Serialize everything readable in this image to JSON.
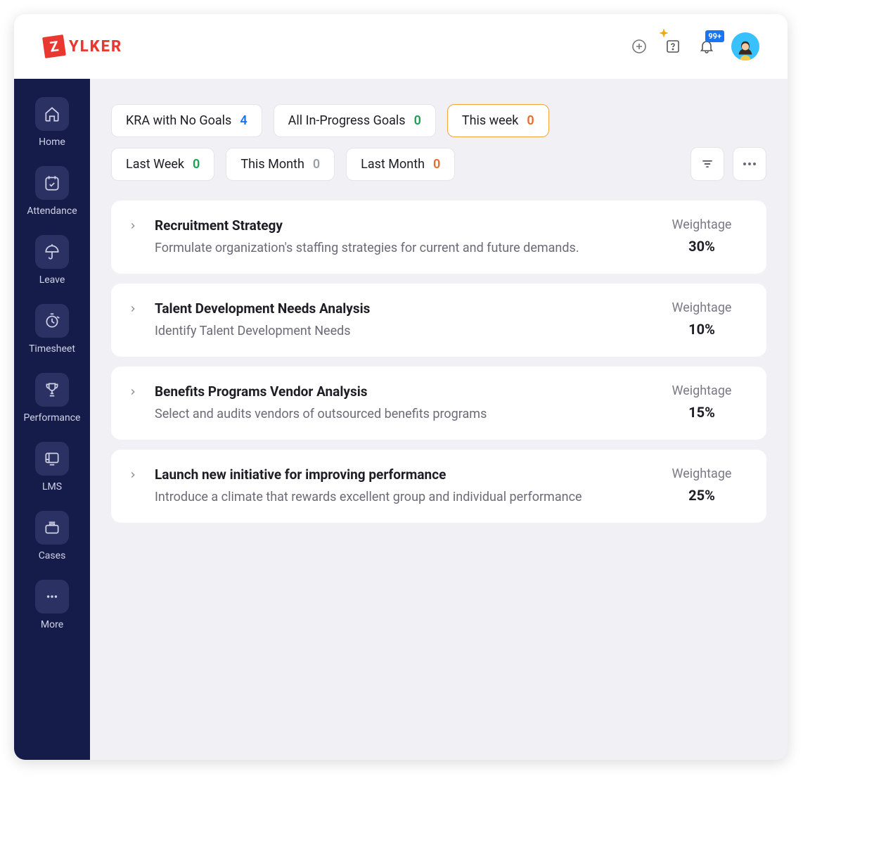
{
  "brand": {
    "badge_letter": "Z",
    "rest": "YLKER"
  },
  "topbar": {
    "notif_badge": "99+"
  },
  "sidebar": {
    "items": [
      {
        "label": "Home"
      },
      {
        "label": "Attendance"
      },
      {
        "label": "Leave"
      },
      {
        "label": "Timesheet"
      },
      {
        "label": "Performance"
      },
      {
        "label": "LMS"
      },
      {
        "label": "Cases"
      },
      {
        "label": "More"
      }
    ]
  },
  "filters": {
    "row1": [
      {
        "label": "KRA with No Goals",
        "count": "4",
        "count_class": "count-blue",
        "active": false
      },
      {
        "label": "All In-Progress Goals",
        "count": "0",
        "count_class": "count-green",
        "active": false
      },
      {
        "label": "This week",
        "count": "0",
        "count_class": "count-orange",
        "active": true
      }
    ],
    "row2": [
      {
        "label": "Last Week",
        "count": "0",
        "count_class": "count-green",
        "active": false
      },
      {
        "label": "This Month",
        "count": "0",
        "count_class": "count-grey",
        "active": false
      },
      {
        "label": "Last Month",
        "count": "0",
        "count_class": "count-orange",
        "active": false
      }
    ]
  },
  "weight_label": "Weightage",
  "kras": [
    {
      "title": "Recruitment Strategy",
      "desc": "Formulate organization's staffing strategies for current and future demands.",
      "weight": "30%"
    },
    {
      "title": "Talent Development Needs Analysis",
      "desc": "Identify Talent Development Needs",
      "weight": "10%"
    },
    {
      "title": "Benefits Programs Vendor Analysis",
      "desc": "Select and audits vendors of outsourced benefits programs",
      "weight": "15%"
    },
    {
      "title": "Launch new initiative for improving performance",
      "desc": "Introduce a climate that rewards excellent group and individual performance",
      "weight": "25%"
    }
  ]
}
